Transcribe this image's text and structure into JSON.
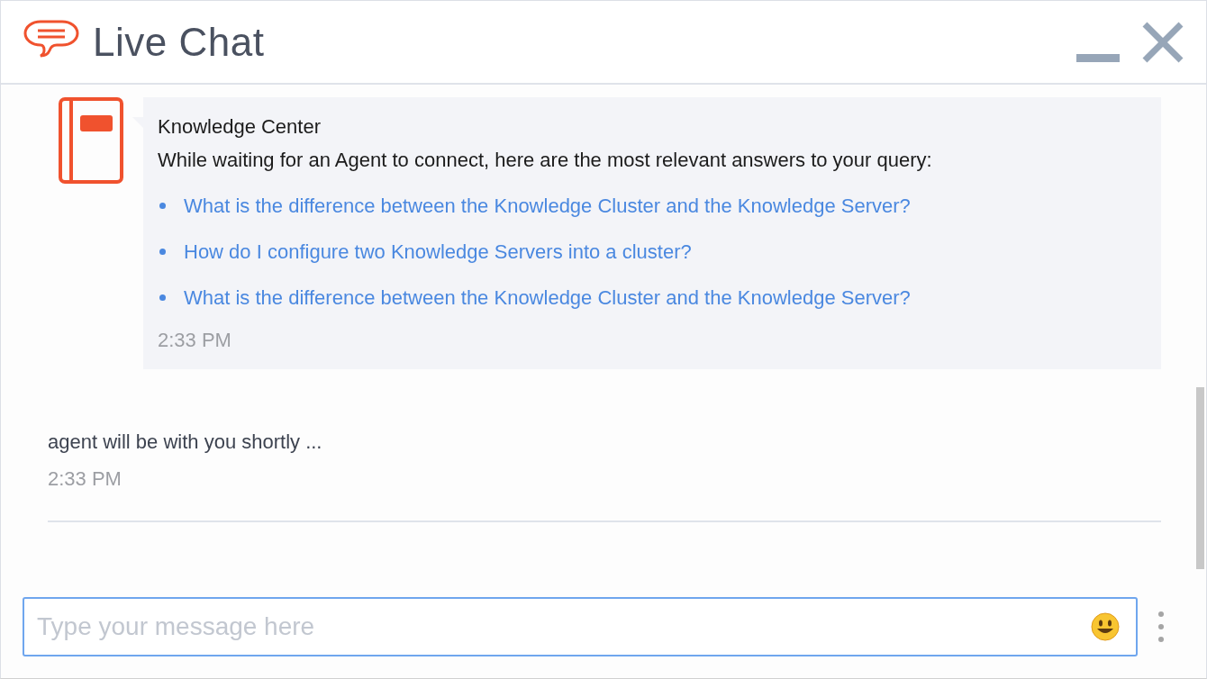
{
  "window": {
    "title": "Live Chat"
  },
  "messages": [
    {
      "kind": "knowledge",
      "sender": "Knowledge Center",
      "text": "While waiting for an Agent to connect, here are the most relevant answers to your query:",
      "links": [
        "What is the difference between the Knowledge Cluster and the Knowledge Server?",
        "How do I configure two Knowledge Servers into a cluster?",
        "What is the difference between the Knowledge Cluster and the Knowledge Server?"
      ],
      "time": "2:33 PM"
    },
    {
      "kind": "system",
      "text": "agent will be with you shortly ...",
      "time": "2:33 PM"
    }
  ],
  "composer": {
    "placeholder": "Type your message here"
  }
}
